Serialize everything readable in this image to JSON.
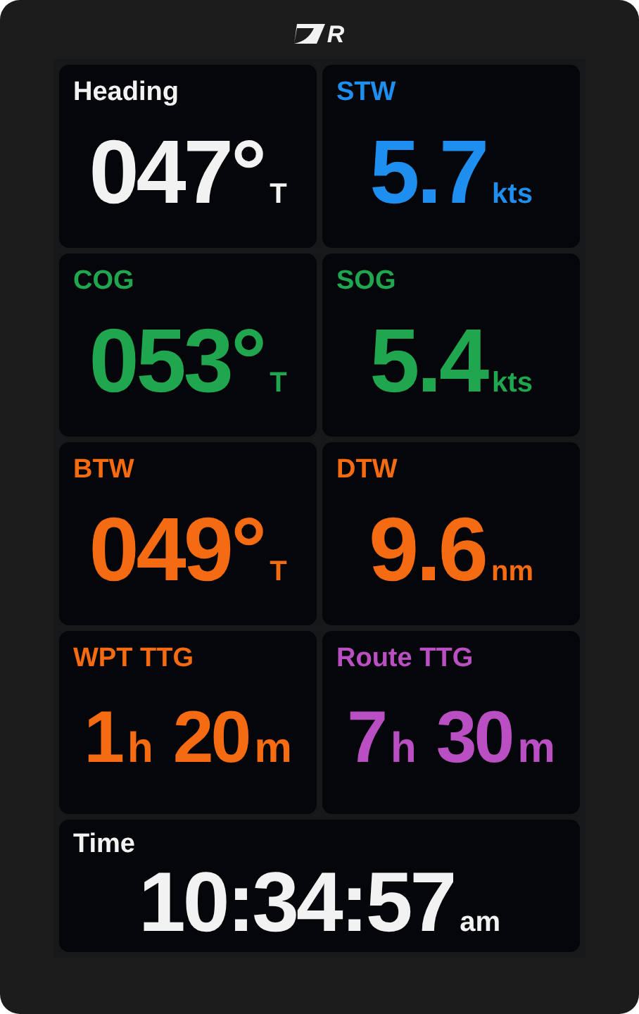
{
  "logo": {
    "letter": "R"
  },
  "tiles": [
    {
      "label": "Heading",
      "color": "#f2f2f2",
      "parts": [
        {
          "value": "047°",
          "unit": "T"
        }
      ]
    },
    {
      "label": "STW",
      "color": "#1e8fef",
      "parts": [
        {
          "value": "5.7",
          "unit": "kts"
        }
      ]
    },
    {
      "label": "COG",
      "color": "#1fa64f",
      "parts": [
        {
          "value": "053°",
          "unit": "T"
        }
      ]
    },
    {
      "label": "SOG",
      "color": "#1fa64f",
      "parts": [
        {
          "value": "5.4",
          "unit": "kts"
        }
      ]
    },
    {
      "label": "BTW",
      "color": "#f56b12",
      "parts": [
        {
          "value": "049°",
          "unit": "T"
        }
      ]
    },
    {
      "label": "DTW",
      "color": "#f56b12",
      "parts": [
        {
          "value": "9.6",
          "unit": "nm"
        }
      ]
    },
    {
      "label": "WPT TTG",
      "color": "#f56b12",
      "parts": [
        {
          "value": "1",
          "unit": "h"
        },
        {
          "value": "20",
          "unit": "m"
        }
      ]
    },
    {
      "label": "Route TTG",
      "color": "#b94fc2",
      "parts": [
        {
          "value": "7",
          "unit": "h"
        },
        {
          "value": "30",
          "unit": "m"
        }
      ]
    }
  ],
  "time": {
    "label": "Time",
    "color": "#f2f2f2",
    "value": "10:34:57",
    "unit": "am"
  }
}
